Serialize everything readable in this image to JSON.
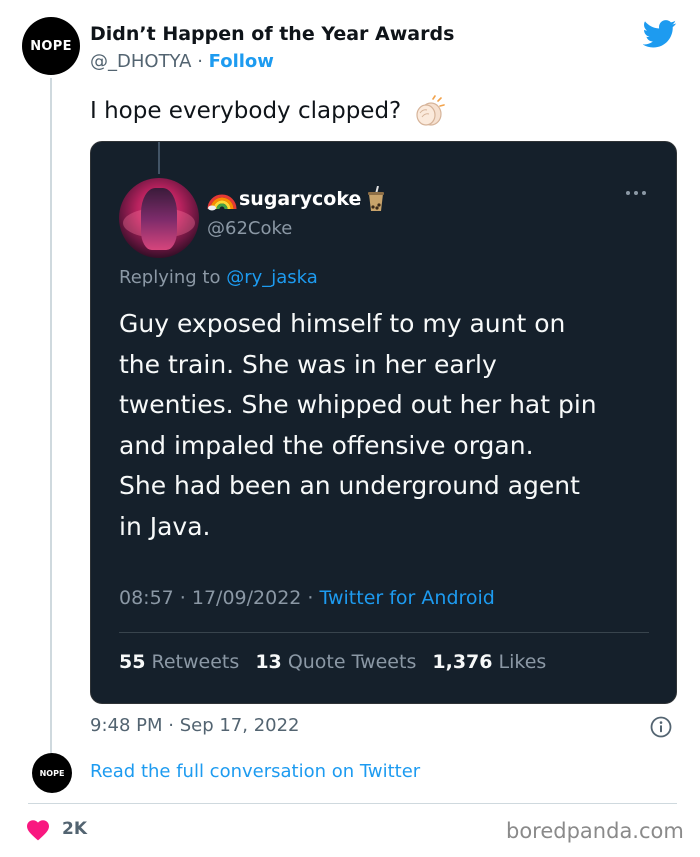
{
  "author": {
    "avatar_text": "NOPE",
    "name": "Didn’t Happen of the Year Awards",
    "handle": "@_DHOTYA",
    "separator": " · ",
    "follow_label": "Follow"
  },
  "tweet": {
    "text": "I hope everybody clapped?",
    "emoji_icon": "clapping-hands-icon",
    "timestamp": "9:48 PM · Sep 17, 2022"
  },
  "quoted": {
    "name": "sugarycoke",
    "handle": "@62Coke",
    "replying_prefix": "Replying to ",
    "replying_to": "@ry_jaska",
    "body_lines": [
      "Guy exposed himself to my aunt on",
      "the train. She was in her early",
      "twenties. She whipped out her hat pin",
      "and impaled the offensive organ.",
      "She had been an underground agent",
      "in Java."
    ],
    "datetime": "08:57 · 17/09/2022 · ",
    "source": "Twitter for Android",
    "retweets_count": "55",
    "retweets_label": "Retweets",
    "quotes_count": "13",
    "quotes_label": "Quote Tweets",
    "likes_count": "1,376",
    "likes_label": "Likes"
  },
  "footer": {
    "small_avatar_text": "NOPE",
    "read_link": "Read the full conversation on Twitter",
    "like_count": "2K",
    "watermark": "boredpanda.com"
  },
  "colors": {
    "accent": "#1d9bf0",
    "heart": "#f91880",
    "quote_bg": "#15202b"
  }
}
